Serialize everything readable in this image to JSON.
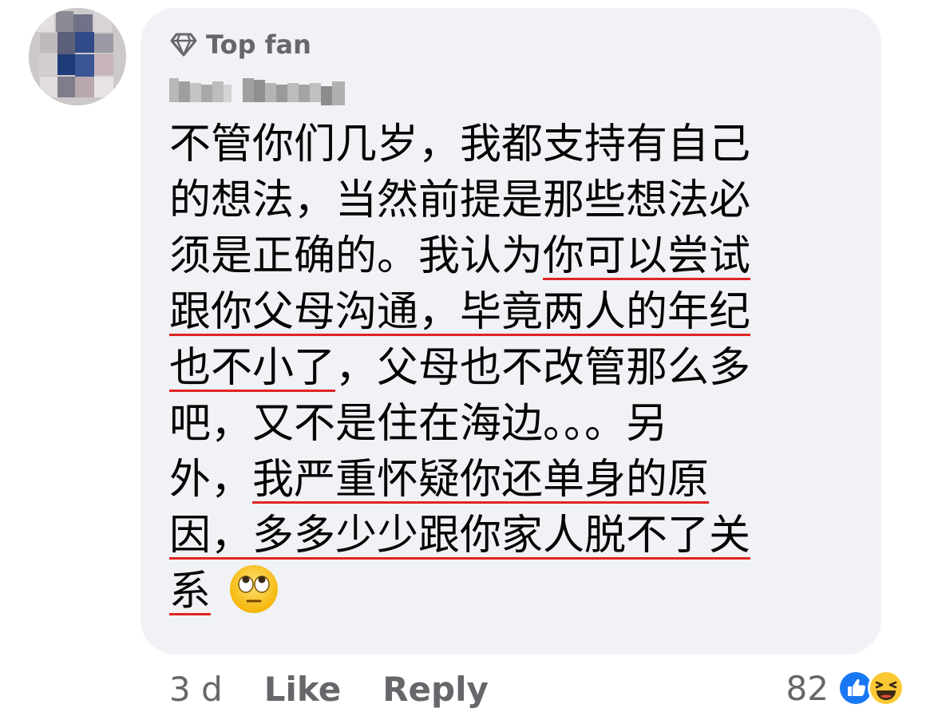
{
  "author": {
    "badge_icon": "diamond-icon",
    "badge_label": "Top fan",
    "avatar": "blurred-profile-photo"
  },
  "comment": {
    "lines": [
      {
        "a": "不管你们几岁，我都支持有自己",
        "u": "",
        "b": ""
      },
      {
        "a": "的想法，当然前提是那些想法必",
        "u": "",
        "b": ""
      },
      {
        "a": "须是正确的。我认为",
        "u": "你可以尝试",
        "b": ""
      },
      {
        "a": "",
        "u": "跟你父母沟通，毕竟两人的年纪",
        "b": ""
      },
      {
        "a": "",
        "u": "也不小了",
        "b": "，父母也不改管那么多"
      },
      {
        "a": "吧，又不是住在海边。。。另",
        "u": "",
        "b": ""
      },
      {
        "a": "外，",
        "u": "我严重怀疑你还单身的原",
        "b": ""
      },
      {
        "a": "",
        "u": "因，多多少少跟你家人脱不了关",
        "b": ""
      },
      {
        "a": "",
        "u": "系",
        "b": ""
      }
    ],
    "emoji": "face-with-rolling-eyes",
    "underline_color": "#e02424"
  },
  "footer": {
    "time": "3 d",
    "like_label": "Like",
    "reply_label": "Reply"
  },
  "reactions": {
    "count": "82",
    "icons": [
      "like-icon",
      "haha-icon"
    ]
  },
  "colors": {
    "bubble": "#f0f2f5",
    "secondary_text": "#65676b",
    "like_blue": "#1877f2"
  }
}
